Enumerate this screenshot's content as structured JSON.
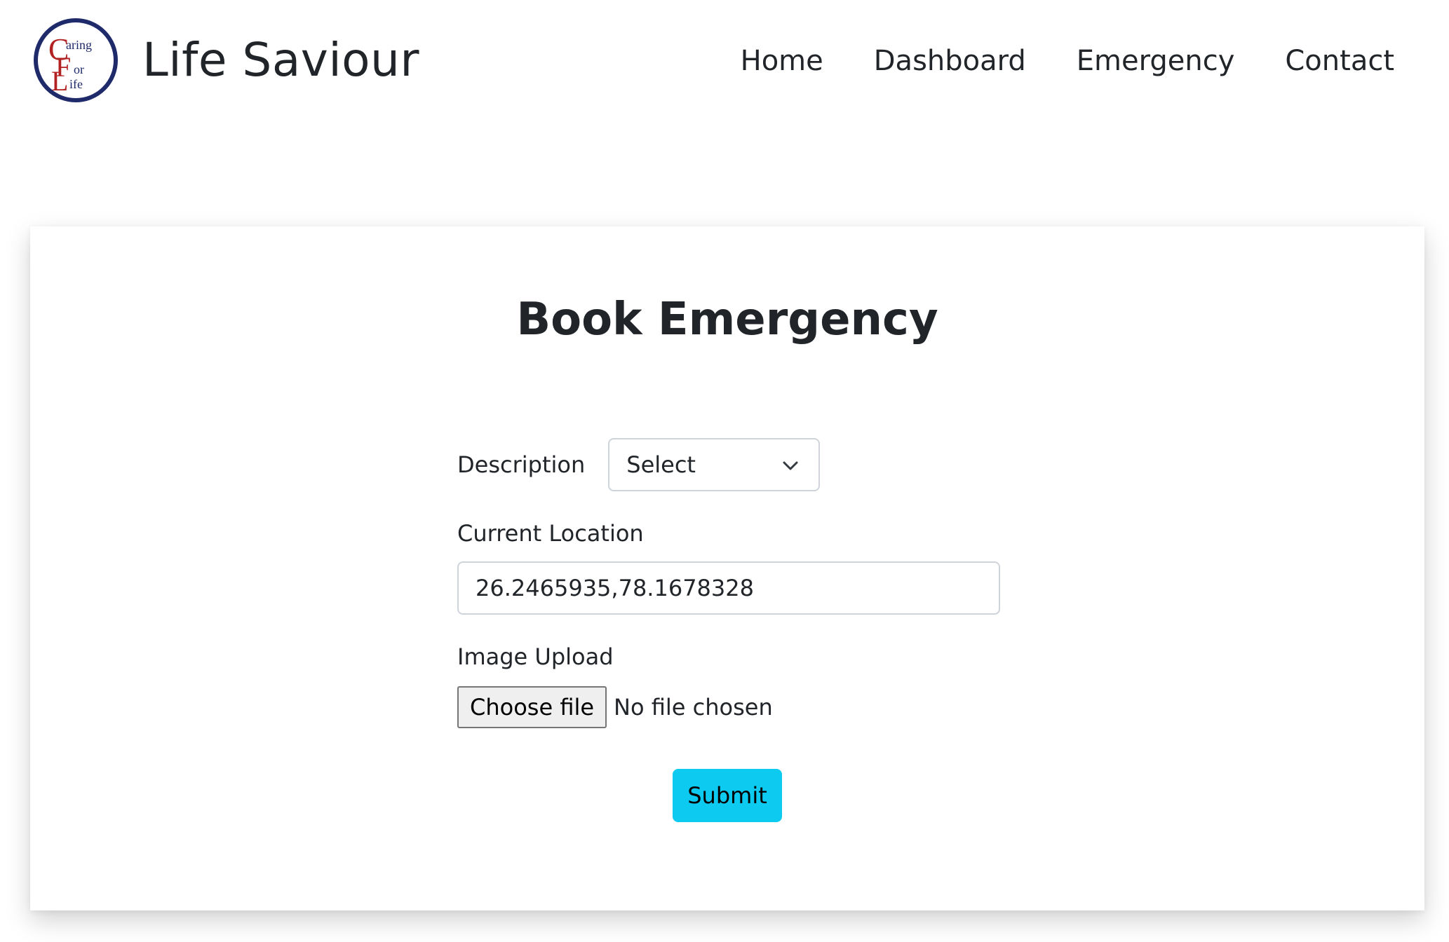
{
  "brand": {
    "name": "Life Saviour",
    "logo": {
      "letters": [
        "C",
        "F",
        "L"
      ],
      "words": [
        "aring",
        "or",
        "ife"
      ],
      "ring_color": "#1f2a6b",
      "letter_color": "#b22222"
    }
  },
  "nav": {
    "items": [
      {
        "label": "Home"
      },
      {
        "label": "Dashboard"
      },
      {
        "label": "Emergency"
      },
      {
        "label": "Contact"
      }
    ]
  },
  "form": {
    "title": "Book Emergency",
    "description_label": "Description",
    "description_selected": "Select",
    "location_label": "Current Location",
    "location_value": "26.2465935,78.1678328",
    "image_label": "Image Upload",
    "file_button_label": "Choose file",
    "file_status": "No file chosen",
    "submit_label": "Submit",
    "submit_color": "#0dcaf0"
  }
}
